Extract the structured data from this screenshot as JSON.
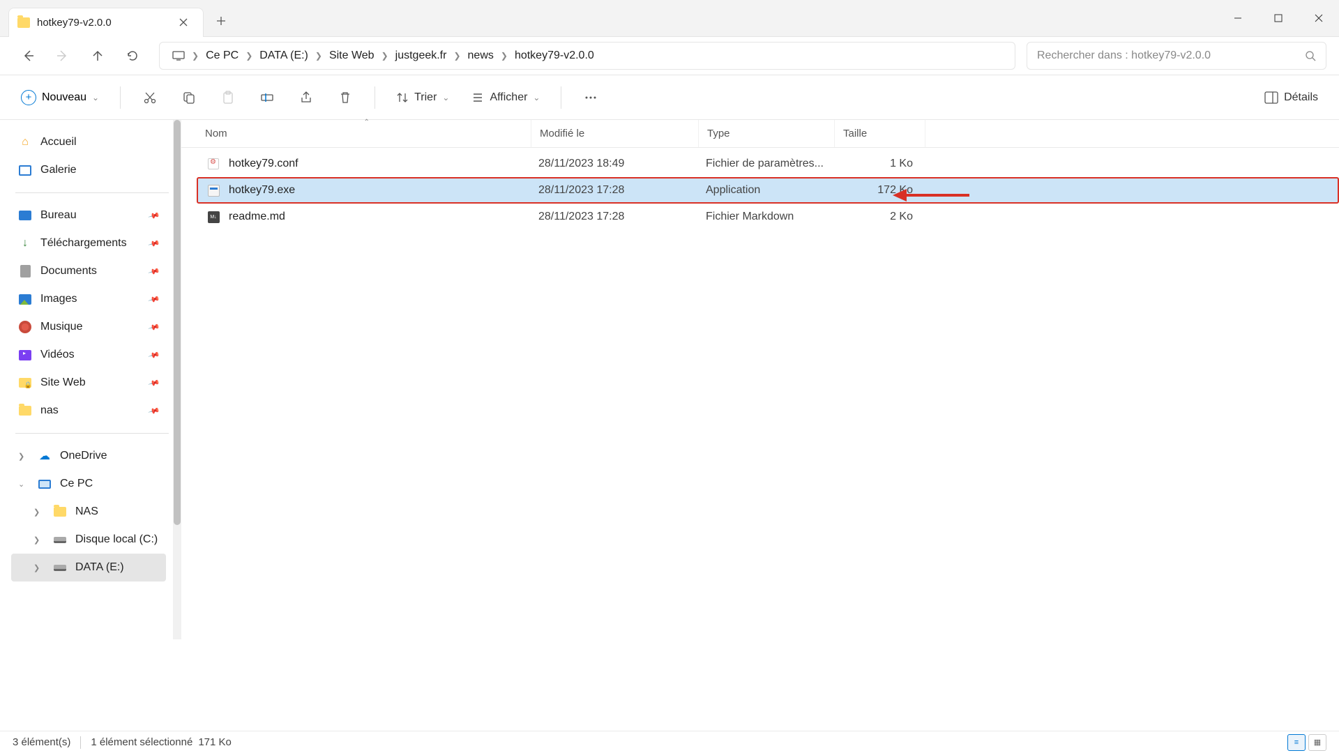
{
  "window": {
    "tab_title": "hotkey79-v2.0.0"
  },
  "breadcrumb": {
    "items": [
      "Ce PC",
      "DATA (E:)",
      "Site Web",
      "justgeek.fr",
      "news",
      "hotkey79-v2.0.0"
    ]
  },
  "search": {
    "placeholder": "Rechercher dans : hotkey79-v2.0.0"
  },
  "toolbar": {
    "new_label": "Nouveau",
    "sort_label": "Trier",
    "view_label": "Afficher",
    "details_label": "Détails"
  },
  "sidebar": {
    "home": "Accueil",
    "gallery": "Galerie",
    "quick": [
      "Bureau",
      "Téléchargements",
      "Documents",
      "Images",
      "Musique",
      "Vidéos",
      "Site Web",
      "nas"
    ],
    "onedrive": "OneDrive",
    "thispc": "Ce PC",
    "drives": [
      "NAS",
      "Disque local (C:)",
      "DATA (E:)"
    ]
  },
  "columns": {
    "name": "Nom",
    "modified": "Modifié le",
    "type": "Type",
    "size": "Taille"
  },
  "files": [
    {
      "name": "hotkey79.conf",
      "modified": "28/11/2023 18:49",
      "type": "Fichier de paramètres...",
      "size": "1 Ko",
      "icon": "conf",
      "selected": false
    },
    {
      "name": "hotkey79.exe",
      "modified": "28/11/2023 17:28",
      "type": "Application",
      "size": "172 Ko",
      "icon": "exe",
      "selected": true
    },
    {
      "name": "readme.md",
      "modified": "28/11/2023 17:28",
      "type": "Fichier Markdown",
      "size": "2 Ko",
      "icon": "md",
      "selected": false
    }
  ],
  "status": {
    "count": "3 élément(s)",
    "selection": "1 élément sélectionné",
    "sel_size": "171 Ko"
  }
}
